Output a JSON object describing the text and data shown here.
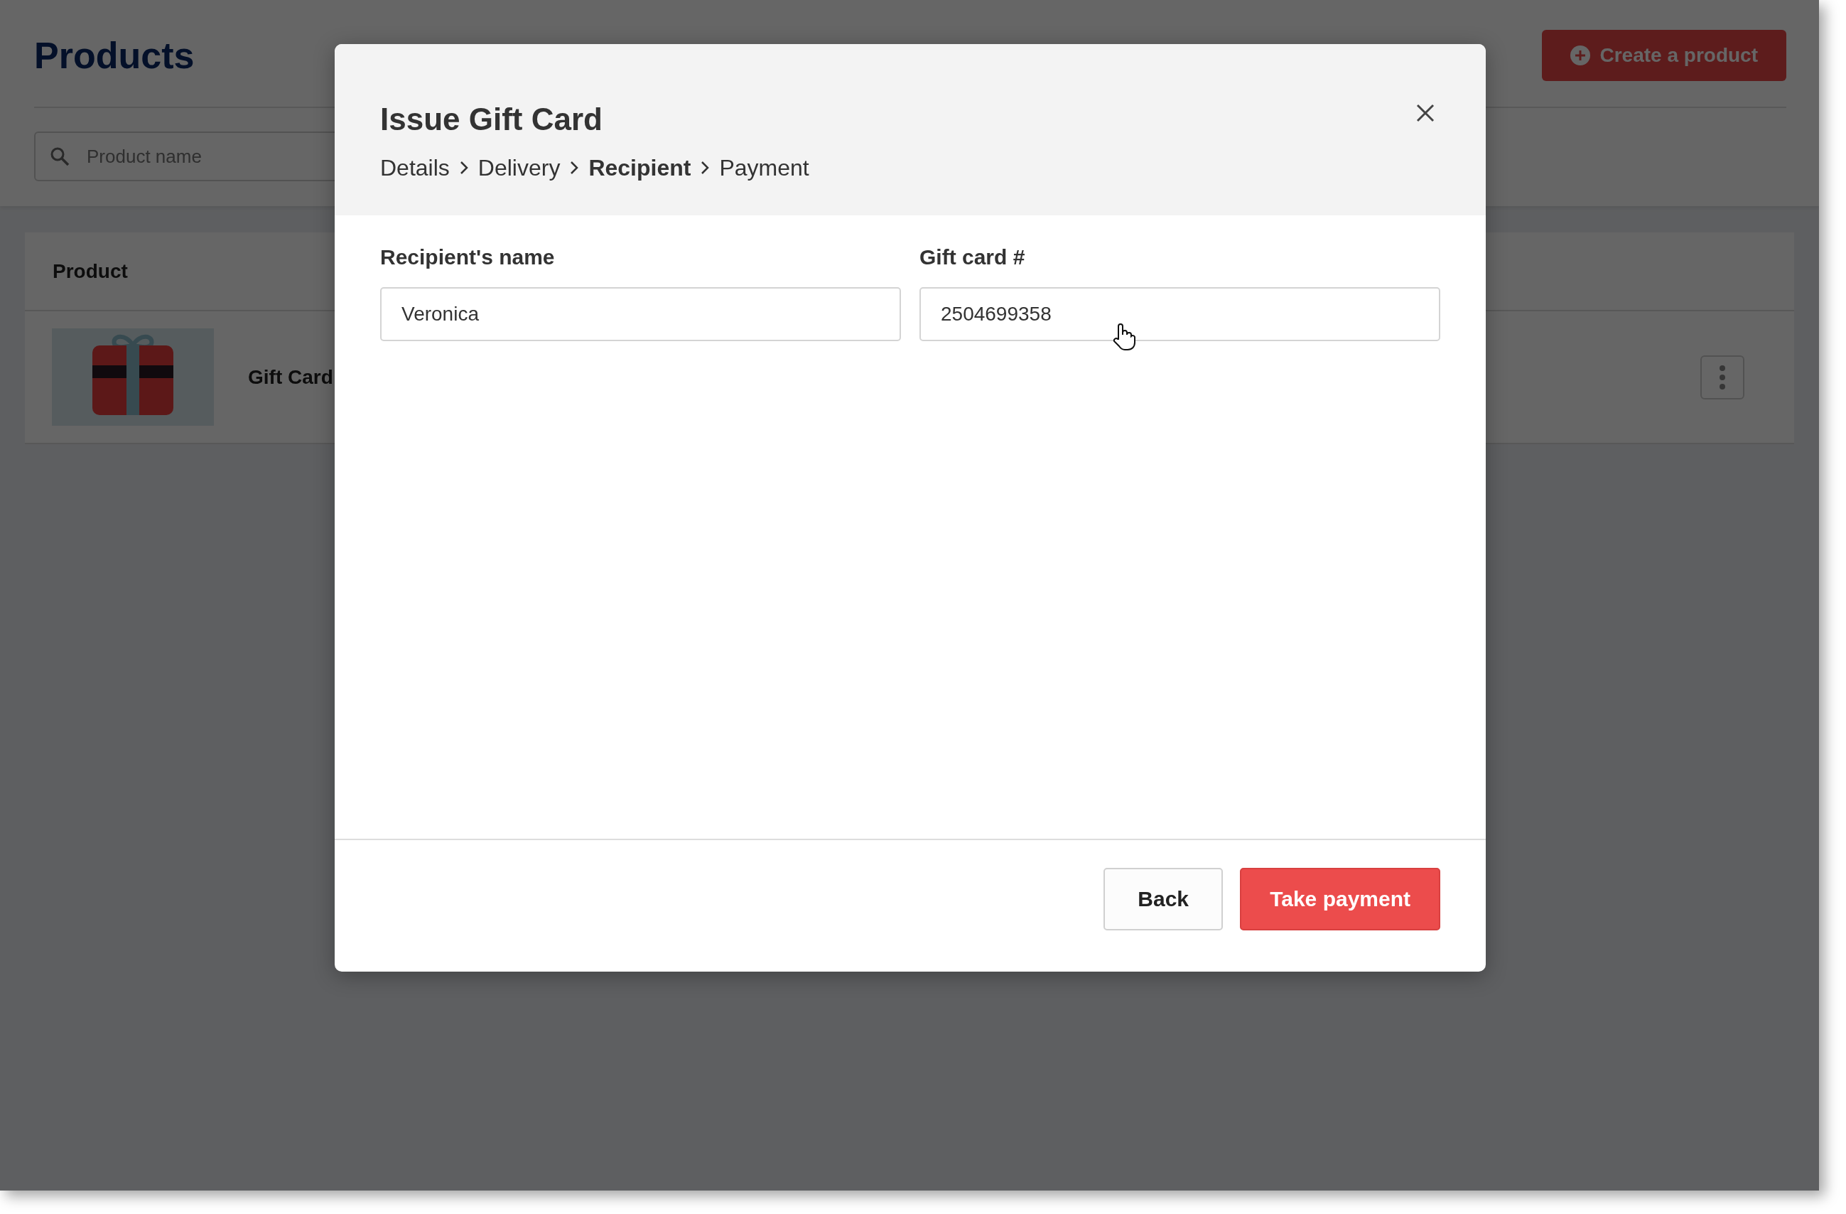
{
  "page": {
    "title": "Products",
    "create_button": "Create a product",
    "search": {
      "placeholder": "Product name"
    },
    "table": {
      "columns": [
        "Product"
      ],
      "rows": [
        {
          "name": "Gift Card"
        }
      ]
    }
  },
  "modal": {
    "title": "Issue Gift Card",
    "steps": [
      {
        "label": "Details",
        "selected": false
      },
      {
        "label": "Delivery",
        "selected": false
      },
      {
        "label": "Recipient",
        "selected": true
      },
      {
        "label": "Payment",
        "selected": false
      }
    ],
    "fields": [
      {
        "label": "Recipient's name",
        "value": "Veronica"
      },
      {
        "label": "Gift card #",
        "value": "2504699358"
      }
    ],
    "buttons": [
      {
        "label": "Back",
        "kind": "secondary"
      },
      {
        "label": "Take payment",
        "kind": "primary"
      }
    ]
  }
}
